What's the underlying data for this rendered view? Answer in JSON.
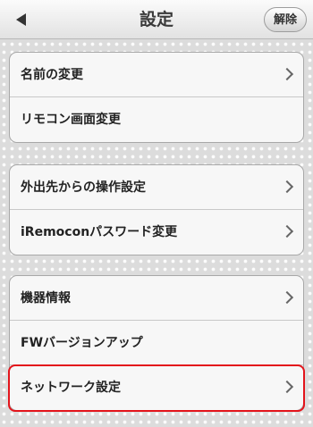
{
  "header": {
    "title": "設定",
    "action_label": "解除"
  },
  "groups": [
    {
      "rows": [
        {
          "label": "名前の変更"
        },
        {
          "label": "リモコン画面変更"
        }
      ]
    },
    {
      "rows": [
        {
          "label": "外出先からの操作設定"
        },
        {
          "label": "iRemoconパスワード変更"
        }
      ]
    },
    {
      "rows": [
        {
          "label": "機器情報"
        },
        {
          "label": "FWバージョンアップ"
        },
        {
          "label": "ネットワーク設定"
        }
      ]
    }
  ],
  "colors": {
    "highlight": "#e3141b"
  }
}
